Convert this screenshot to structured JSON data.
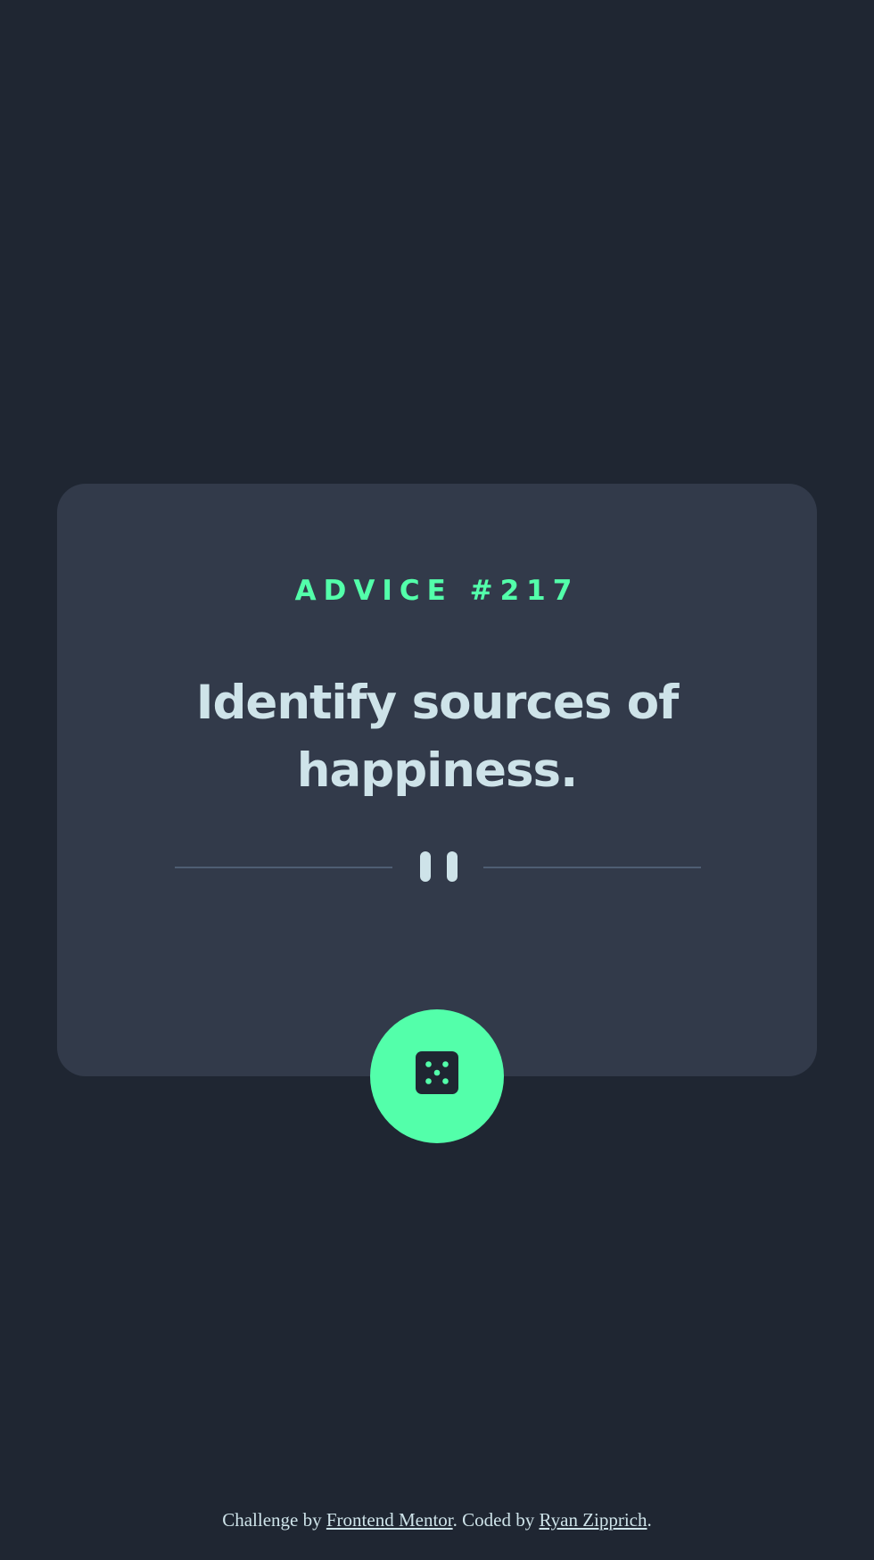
{
  "card": {
    "advice_id": "ADVICE #217",
    "advice_text": "Identify sources of happiness."
  },
  "divider": {
    "icon": "pause-icon"
  },
  "dice_button": {
    "icon": "dice-icon"
  },
  "footer": {
    "prefix": "Challenge by ",
    "link1": "Frontend Mentor",
    "middle": ". Coded by ",
    "link2": "Ryan Zipprich",
    "suffix": "."
  },
  "colors": {
    "background": "#1f2632",
    "card": "#323a4a",
    "accent": "#53ffaa",
    "text": "#cee3e9",
    "divider": "#4e5d73"
  }
}
